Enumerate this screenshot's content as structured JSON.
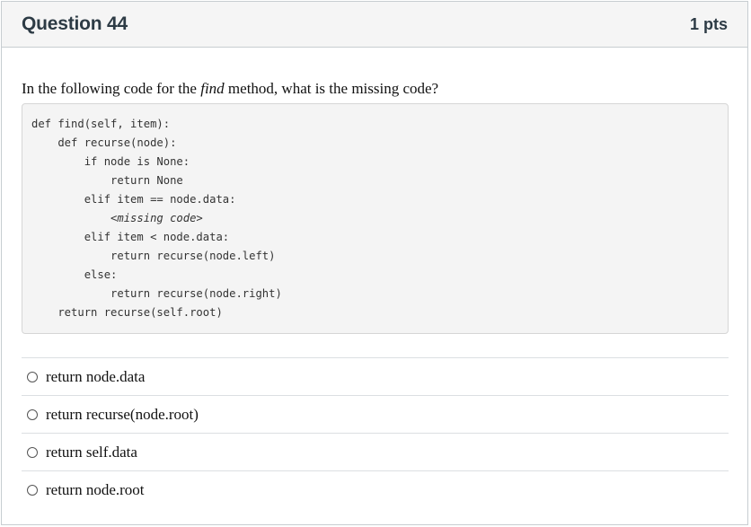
{
  "question": {
    "title": "Question 44",
    "points": "1 pts",
    "prompt_before": "In the following code for the ",
    "prompt_italic": "find",
    "prompt_after": " method, what is the missing code?"
  },
  "code": {
    "lines": [
      "def find(self, item):",
      "    def recurse(node):",
      "        if node is None:",
      "            return None",
      "        elif item == node.data:",
      "            <missing code>",
      "        elif item < node.data:",
      "            return recurse(node.left)",
      "        else:",
      "            return recurse(node.right)",
      "    return recurse(self.root)"
    ]
  },
  "answers": [
    {
      "label": "return node.data"
    },
    {
      "label": "return recurse(node.root)"
    },
    {
      "label": "return self.data"
    },
    {
      "label": "return node.root"
    }
  ]
}
